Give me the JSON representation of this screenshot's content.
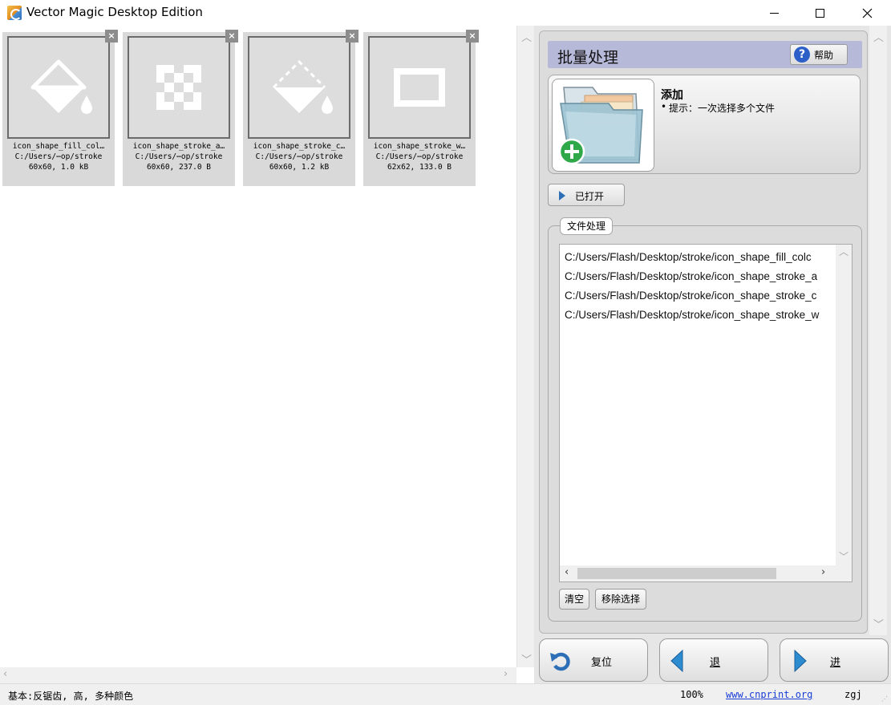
{
  "window": {
    "title": "Vector Magic Desktop Edition"
  },
  "thumbnails": [
    {
      "name": "icon_shape_fill_col…",
      "path": "C:/Users/⋯op/stroke",
      "info": "60x60, 1.0 kB",
      "icon": "droplet-fill-icon"
    },
    {
      "name": "icon_shape_stroke_a…",
      "path": "C:/Users/⋯op/stroke",
      "info": "60x60, 237.0 B",
      "icon": "checkerboard-icon"
    },
    {
      "name": "icon_shape_stroke_c…",
      "path": "C:/Users/⋯op/stroke",
      "info": "60x60, 1.2 kB",
      "icon": "dashed-droplet-icon"
    },
    {
      "name": "icon_shape_stroke_w…",
      "path": "C:/Users/⋯op/stroke",
      "info": "62x62, 133.0 B",
      "icon": "rectangle-outline-icon"
    }
  ],
  "panel": {
    "title": "批量处理",
    "help_label": "帮助",
    "add_heading": "添加",
    "add_tip": "提示：一次选择多个文件",
    "opened_label": "已打开",
    "group_label": "文件处理",
    "files": [
      "C:/Users/Flash/Desktop/stroke/icon_shape_fill_colc",
      "C:/Users/Flash/Desktop/stroke/icon_shape_stroke_a",
      "C:/Users/Flash/Desktop/stroke/icon_shape_stroke_c",
      "C:/Users/Flash/Desktop/stroke/icon_shape_stroke_w"
    ],
    "clear_label": "清空",
    "remove_label": "移除选择"
  },
  "nav": {
    "reset_label": "复位",
    "back_label": "退",
    "next_label": "进"
  },
  "status": {
    "left": "基本:反锯齿, 高, 多种颜色",
    "zoom": "100%",
    "link": "www.cnprint.org",
    "user": "zgj"
  },
  "colors": {
    "panel_header": "#b7b9d8",
    "accent_blue": "#2d6fb7",
    "link": "#1a3dd6"
  }
}
